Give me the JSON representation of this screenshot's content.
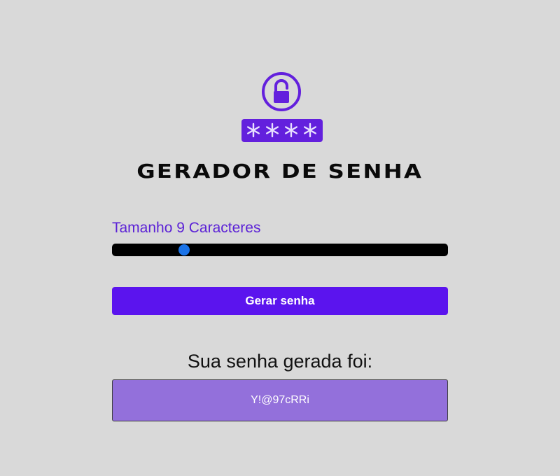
{
  "app": {
    "logo_icon": "lock-password-icon",
    "title": "GERADOR DE SENHA"
  },
  "length": {
    "label": "Tamanho 9 Caracteres",
    "value": 9,
    "min": 1,
    "max": 40
  },
  "generate": {
    "label": "Gerar senha"
  },
  "result": {
    "label": "Sua senha gerada foi:",
    "password": "Y!@97cRRi"
  },
  "colors": {
    "background": "#d9d9d9",
    "accent": "#5b14ee",
    "label_purple": "#5b21d6",
    "password_box": "#9370db",
    "slider_thumb": "#1a73e8"
  }
}
